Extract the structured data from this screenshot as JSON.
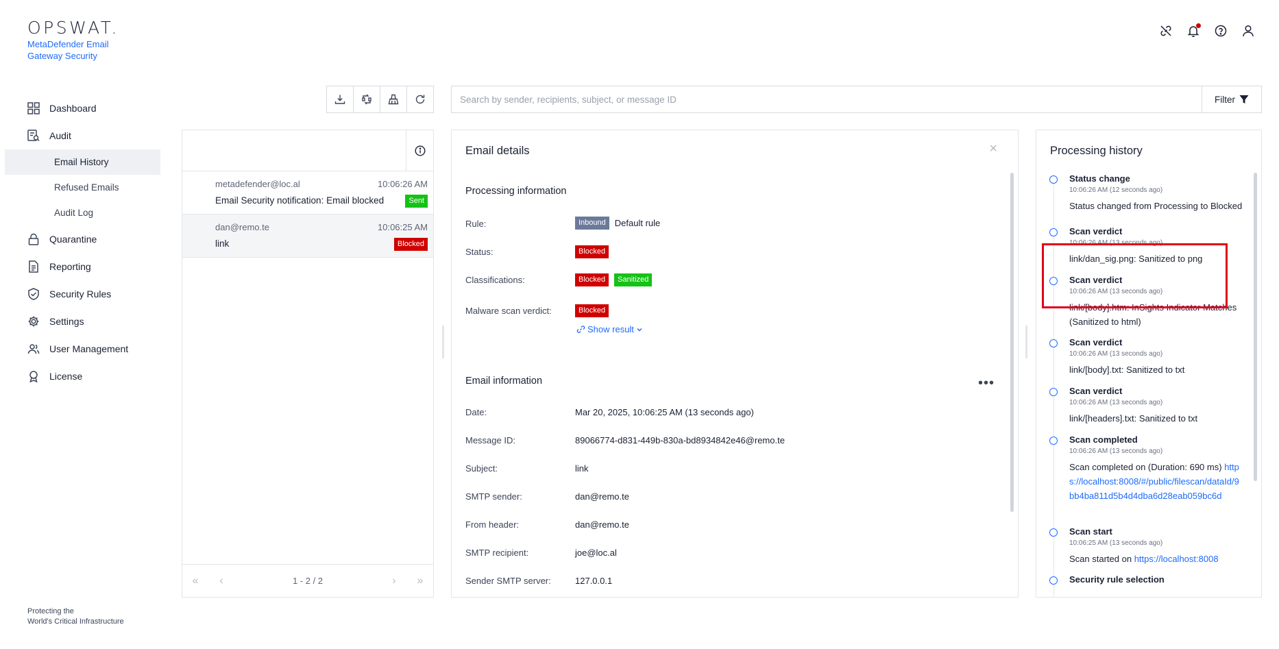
{
  "brand": {
    "logo_text": "OPSWAT.",
    "product": "MetaDefender Email Gateway Security",
    "tagline_1": "Protecting the",
    "tagline_2": "World's Critical Infrastructure"
  },
  "nav": {
    "dashboard": "Dashboard",
    "audit": "Audit",
    "email_history": "Email History",
    "refused_emails": "Refused Emails",
    "audit_log": "Audit Log",
    "quarantine": "Quarantine",
    "reporting": "Reporting",
    "security_rules": "Security Rules",
    "settings": "Settings",
    "user_management": "User Management",
    "license": "License"
  },
  "search": {
    "placeholder": "Search by sender, recipients, subject, or message ID",
    "filter_label": "Filter"
  },
  "email_list": [
    {
      "from": "metadefender@loc.al",
      "time": "10:06:26 AM",
      "subject": "Email Security notification: Email blocked",
      "status": "Sent"
    },
    {
      "from": "dan@remo.te",
      "time": "10:06:25 AM",
      "subject": "link",
      "status": "Blocked"
    }
  ],
  "pager": {
    "info": "1 - 2 / 2"
  },
  "details": {
    "title": "Email details",
    "processing_title": "Processing information",
    "rule_label": "Rule:",
    "rule_tag": "Inbound",
    "rule_value": "Default rule",
    "status_label": "Status:",
    "status_value": "Blocked",
    "classifications_label": "Classifications:",
    "classification_1": "Blocked",
    "classification_2": "Sanitized",
    "malware_label": "Malware scan verdict:",
    "malware_value": "Blocked",
    "show_result": "Show result",
    "email_info_title": "Email information",
    "date_label": "Date:",
    "date_value": "Mar 20, 2025, 10:06:25 AM (13 seconds ago)",
    "msgid_label": "Message ID:",
    "msgid_value": "89066774-d831-449b-830a-bd8934842e46@remo.te",
    "subject_label": "Subject:",
    "subject_value": "link",
    "smtp_sender_label": "SMTP sender:",
    "smtp_sender_value": "dan@remo.te",
    "from_header_label": "From header:",
    "from_header_value": "dan@remo.te",
    "smtp_recipient_label": "SMTP recipient:",
    "smtp_recipient_value": "joe@loc.al",
    "sender_server_label": "Sender SMTP server:",
    "sender_server_value": "127.0.0.1"
  },
  "history": {
    "title": "Processing history",
    "items": [
      {
        "title": "Status change",
        "time": "10:06:26 AM (12 seconds ago)",
        "text": "Status changed from Processing to Blocked"
      },
      {
        "title": "Scan verdict",
        "time": "10:06:26 AM (13 seconds ago)",
        "text": "link/dan_sig.png: Sanitized to png"
      },
      {
        "title": "Scan verdict",
        "time": "10:06:26 AM (13 seconds ago)",
        "text": "link/[body].htm: InSights Indicator Matches (Sanitized to html)"
      },
      {
        "title": "Scan verdict",
        "time": "10:06:26 AM (13 seconds ago)",
        "text": "link/[body].txt: Sanitized to txt"
      },
      {
        "title": "Scan verdict",
        "time": "10:06:26 AM (13 seconds ago)",
        "text": "link/[headers].txt: Sanitized to txt"
      },
      {
        "title": "Scan completed",
        "time": "10:06:26 AM (13 seconds ago)",
        "text": "Scan completed on (Duration: 690 ms)",
        "link": "https://localhost:8008/#/public/filescan/dataId/9bb4ba811d5b4d4dba6d28eab059bc6d"
      },
      {
        "title": "Scan start",
        "time": "10:06:25 AM (13 seconds ago)",
        "text": "Scan started on",
        "link": "https://localhost:8008"
      },
      {
        "title": "Security rule selection",
        "time": "",
        "text": ""
      }
    ]
  },
  "colors": {
    "accent": "#1d6bfc",
    "blocked": "#d00000",
    "sent": "#15c215",
    "highlight": "#e0001b"
  }
}
